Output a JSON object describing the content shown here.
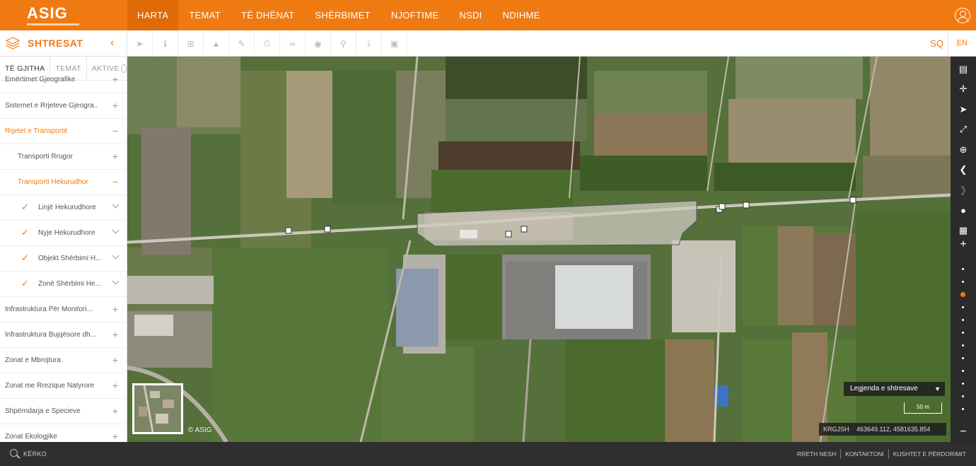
{
  "app": {
    "logo_text": "ASIG",
    "copyright": "© ASIG"
  },
  "nav": {
    "items": [
      "HARTA",
      "TEMAT",
      "TË DHËNAT",
      "SHËRBIMET",
      "NJOFTIME",
      "NSDI",
      "NDIHME"
    ],
    "active": "HARTA"
  },
  "layers_panel": {
    "title": "SHTRESAT",
    "tabs": [
      "TË GJITHA",
      "TEMAT",
      "AKTIVE"
    ],
    "rows": [
      {
        "label": "Emërtimet Gjeografike",
        "control": "+"
      },
      {
        "label": "Sistemet e Rrjeteve Gjeogra...",
        "control": "+"
      },
      {
        "label": "Rrjetet e Transportit",
        "control": "−"
      },
      {
        "label": "Transporti Rrugor",
        "control": "+"
      },
      {
        "label": "Transporti Hekurudhor",
        "control": "−"
      },
      {
        "label": "Linjë Hekurudhore",
        "checked": true
      },
      {
        "label": "Nyje Hekurudhore",
        "checked": true
      },
      {
        "label": "Objekt Shërbimi H...",
        "checked": true
      },
      {
        "label": "Zonë Shërbimi He...",
        "checked": true
      },
      {
        "label": "Infrastruktura Për Monitori...",
        "control": "+"
      },
      {
        "label": "Infrastruktura Bujqësore dh...",
        "control": "+"
      },
      {
        "label": "Zonat e Mbrojtura",
        "control": "+"
      },
      {
        "label": "Zonat me Rrezique Natyrore",
        "control": "+"
      },
      {
        "label": "Shpërndarja e Specieve",
        "control": "+"
      },
      {
        "label": "Zonat Ekologjike",
        "control": "+"
      }
    ]
  },
  "toolbar": {
    "tools": [
      "select-tool-icon",
      "info-icon",
      "add-icon",
      "profile-chart-icon",
      "edit-icon",
      "print-icon",
      "link-icon",
      "locate-icon",
      "search-tool-icon",
      "download-icon",
      "image-icon"
    ]
  },
  "language": {
    "sq": "SQ",
    "en": "EN",
    "active": "SQ"
  },
  "map_overlay": {
    "legend_label": "Legjenda e shtresave",
    "scale_label": "50 m",
    "crs": "KRGJSH",
    "coordinates": "463649.112, 4581635.854"
  },
  "right_toolbar": {
    "buttons": [
      "basemap-icon",
      "fullscreen-icon",
      "geolocate-icon",
      "expand-icon",
      "zoom-box-icon",
      "previous-extent-icon",
      "next-extent-icon",
      "globe-icon",
      "grid-icon",
      "zoom-in-icon",
      "zoom-out-icon"
    ],
    "zoom_levels": 13,
    "active_zoom_level": 3
  },
  "footer": {
    "search_label": "KËRKO",
    "links": [
      "RRETH NESH",
      "KONTAKTONI",
      "KUSHTET E PËRDORIMIT"
    ]
  },
  "colors": {
    "accent": "#f07a12",
    "dark": "#2f2f2f"
  }
}
